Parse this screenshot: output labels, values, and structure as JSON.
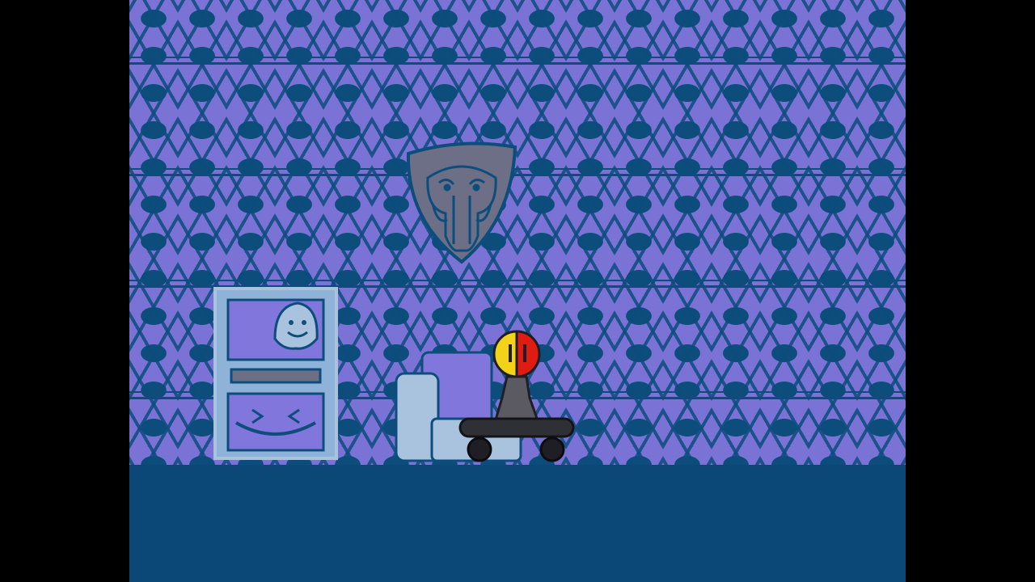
{
  "scene": {
    "type": "game-room",
    "colors": {
      "letterbox": "#000000",
      "wall_light": "#7b72d6",
      "wall_dark": "#0c4d7c",
      "floor": "#0b4877",
      "shield": "#6d6f86",
      "poster_frame": "#8fb2d8",
      "chair_light": "#a9c3df",
      "chair_seat": "#8076dc",
      "skateboard": "#2f2f36",
      "character_body": "#5b5a62",
      "character_face_left": "#f2d318",
      "character_face_right": "#e01c12"
    },
    "objects": [
      {
        "name": "elephant-shield-trophy",
        "icon": "elephant-face-icon"
      },
      {
        "name": "wall-poster",
        "icon": "smiling-face-icon"
      },
      {
        "name": "armchair",
        "icon": "armchair-icon"
      },
      {
        "name": "player-character-on-skateboard",
        "icon": "split-face-icon"
      }
    ]
  }
}
